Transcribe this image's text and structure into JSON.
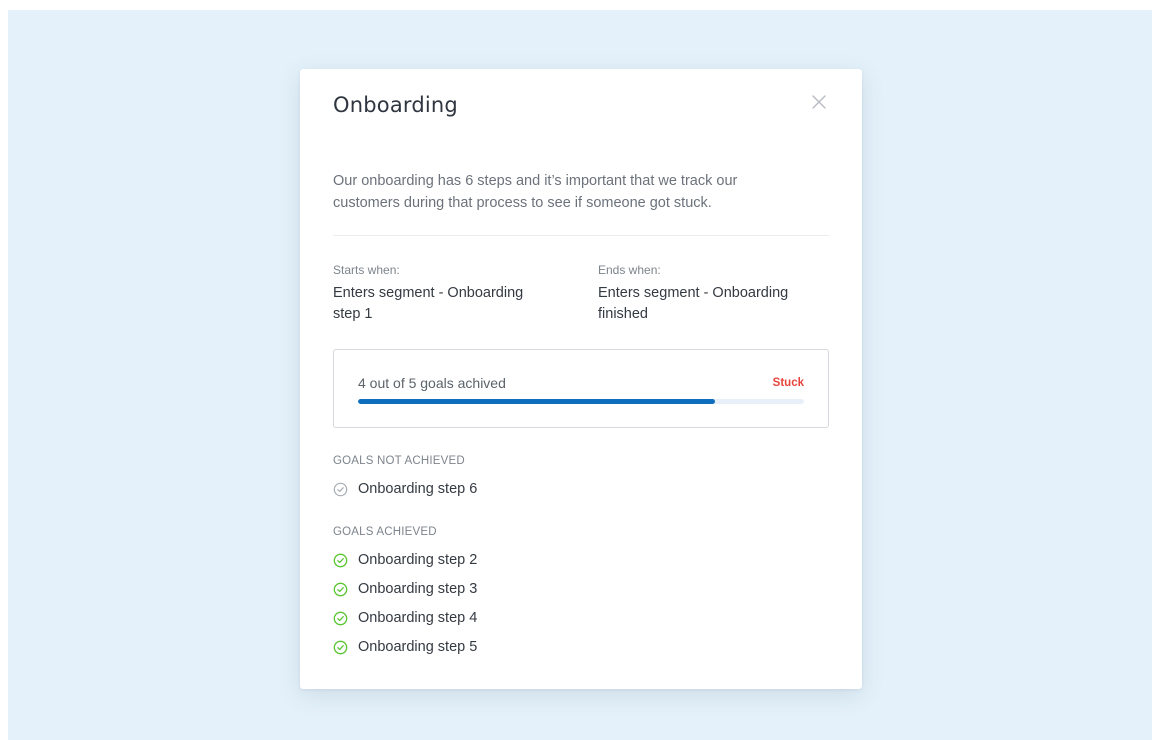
{
  "modal": {
    "title": "Onboarding",
    "description": "Our onboarding has 6 steps and it’s important that we track our customers during that process to see if someone got stuck.",
    "start": {
      "label": "Starts when:",
      "value": "Enters segment - Onboarding step 1"
    },
    "end": {
      "label": "Ends when:",
      "value": "Enters segment - Onboarding finished"
    },
    "progress": {
      "text": "4 out of 5 goals achived",
      "status": "Stuck",
      "fraction": 0.8
    },
    "not_achieved": {
      "heading": "GOALS NOT ACHIEVED",
      "items": [
        "Onboarding step 6"
      ]
    },
    "achieved": {
      "heading": "GOALS ACHIEVED",
      "items": [
        "Onboarding step 2",
        "Onboarding step 3",
        "Onboarding step 4",
        "Onboarding step 5"
      ]
    }
  },
  "icons": {
    "close": "close-icon",
    "pending": "check-circle-outline-icon",
    "done": "check-circle-icon"
  },
  "colors": {
    "backdrop": "#e4f1fa",
    "progress_fill": "#0f6fbe",
    "stuck": "#e8453c",
    "achieved": "#5cc534",
    "pending": "#a7adb3"
  }
}
